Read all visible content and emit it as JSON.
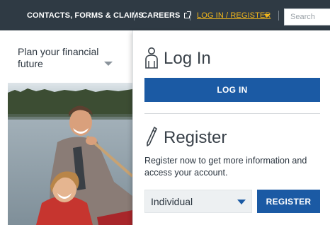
{
  "nav": {
    "contacts_label": "CONTACTS, FORMS & CLAIMS",
    "careers_label": "CAREERS",
    "login_label": "LOG IN / REGISTER",
    "search_placeholder": "Search"
  },
  "plan": {
    "label": "Plan your financial future"
  },
  "login": {
    "title": "Log In",
    "button_label": "LOG IN"
  },
  "register": {
    "title": "Register",
    "description": "Register now to get more information and access your account.",
    "account_type_selected": "Individual",
    "button_label": "REGISTER"
  },
  "colors": {
    "nav_background": "#2f3a44",
    "nav_active": "#f0b51c",
    "primary_button": "#1b5aa4"
  }
}
